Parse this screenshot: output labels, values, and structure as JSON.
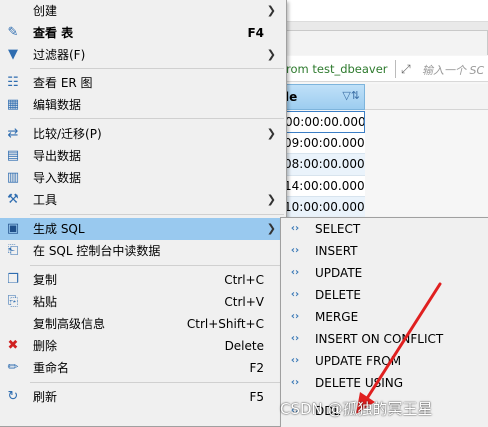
{
  "background": {
    "query_text": "rom test_dbeaver",
    "filter_hint": "输入一个 SC",
    "column_header": "le",
    "grid_values": [
      "00:00:00.000",
      "09:00:00.000",
      "08:00:00.000",
      "14:00:00.000",
      "10:00:00.000"
    ]
  },
  "main_menu": {
    "items": [
      {
        "label": "创建",
        "shortcut": "",
        "has_submenu": true,
        "icon": "none"
      },
      {
        "label": "查看 表",
        "shortcut": "F4",
        "has_submenu": false,
        "icon": "pencil-icon"
      },
      {
        "label": "过滤器(F)",
        "shortcut": "",
        "has_submenu": true,
        "icon": "filter-icon"
      },
      {
        "label": "查看 ER 图",
        "shortcut": "",
        "has_submenu": false,
        "icon": "er-diagram-icon"
      },
      {
        "label": "编辑数据",
        "shortcut": "",
        "has_submenu": false,
        "icon": "edit-data-icon"
      },
      {
        "label": "比较/迁移(P)",
        "shortcut": "",
        "has_submenu": true,
        "icon": "compare-icon"
      },
      {
        "label": "导出数据",
        "shortcut": "",
        "has_submenu": false,
        "icon": "export-icon"
      },
      {
        "label": "导入数据",
        "shortcut": "",
        "has_submenu": false,
        "icon": "import-icon"
      },
      {
        "label": "工具",
        "shortcut": "",
        "has_submenu": true,
        "icon": "tools-icon"
      },
      {
        "label": "生成 SQL",
        "shortcut": "",
        "has_submenu": true,
        "icon": "sql-icon"
      },
      {
        "label": "在 SQL 控制台中读数据",
        "shortcut": "",
        "has_submenu": false,
        "icon": "sql-console-icon"
      },
      {
        "label": "复制",
        "shortcut": "Ctrl+C",
        "has_submenu": false,
        "icon": "copy-icon"
      },
      {
        "label": "粘贴",
        "shortcut": "Ctrl+V",
        "has_submenu": false,
        "icon": "paste-icon"
      },
      {
        "label": "复制高级信息",
        "shortcut": "Ctrl+Shift+C",
        "has_submenu": false,
        "icon": "none"
      },
      {
        "label": "删除",
        "shortcut": "Delete",
        "has_submenu": false,
        "icon": "delete-icon"
      },
      {
        "label": "重命名",
        "shortcut": "F2",
        "has_submenu": false,
        "icon": "rename-icon"
      },
      {
        "label": "刷新",
        "shortcut": "F5",
        "has_submenu": false,
        "icon": "refresh-icon"
      }
    ]
  },
  "sub_menu": {
    "items": [
      {
        "label": "SELECT"
      },
      {
        "label": "INSERT"
      },
      {
        "label": "UPDATE"
      },
      {
        "label": "DELETE"
      },
      {
        "label": "MERGE"
      },
      {
        "label": "INSERT ON CONFLICT"
      },
      {
        "label": "UPDATE FROM"
      },
      {
        "label": "DELETE USING"
      },
      {
        "label": "DDL"
      }
    ]
  },
  "watermark": "CSDN @孤独的冥王星",
  "colors": {
    "menu_bg": "#f0f0f0",
    "highlight": "#99c9ef",
    "arrow": "#e02020",
    "sql_icon": "#3d7bb8"
  }
}
